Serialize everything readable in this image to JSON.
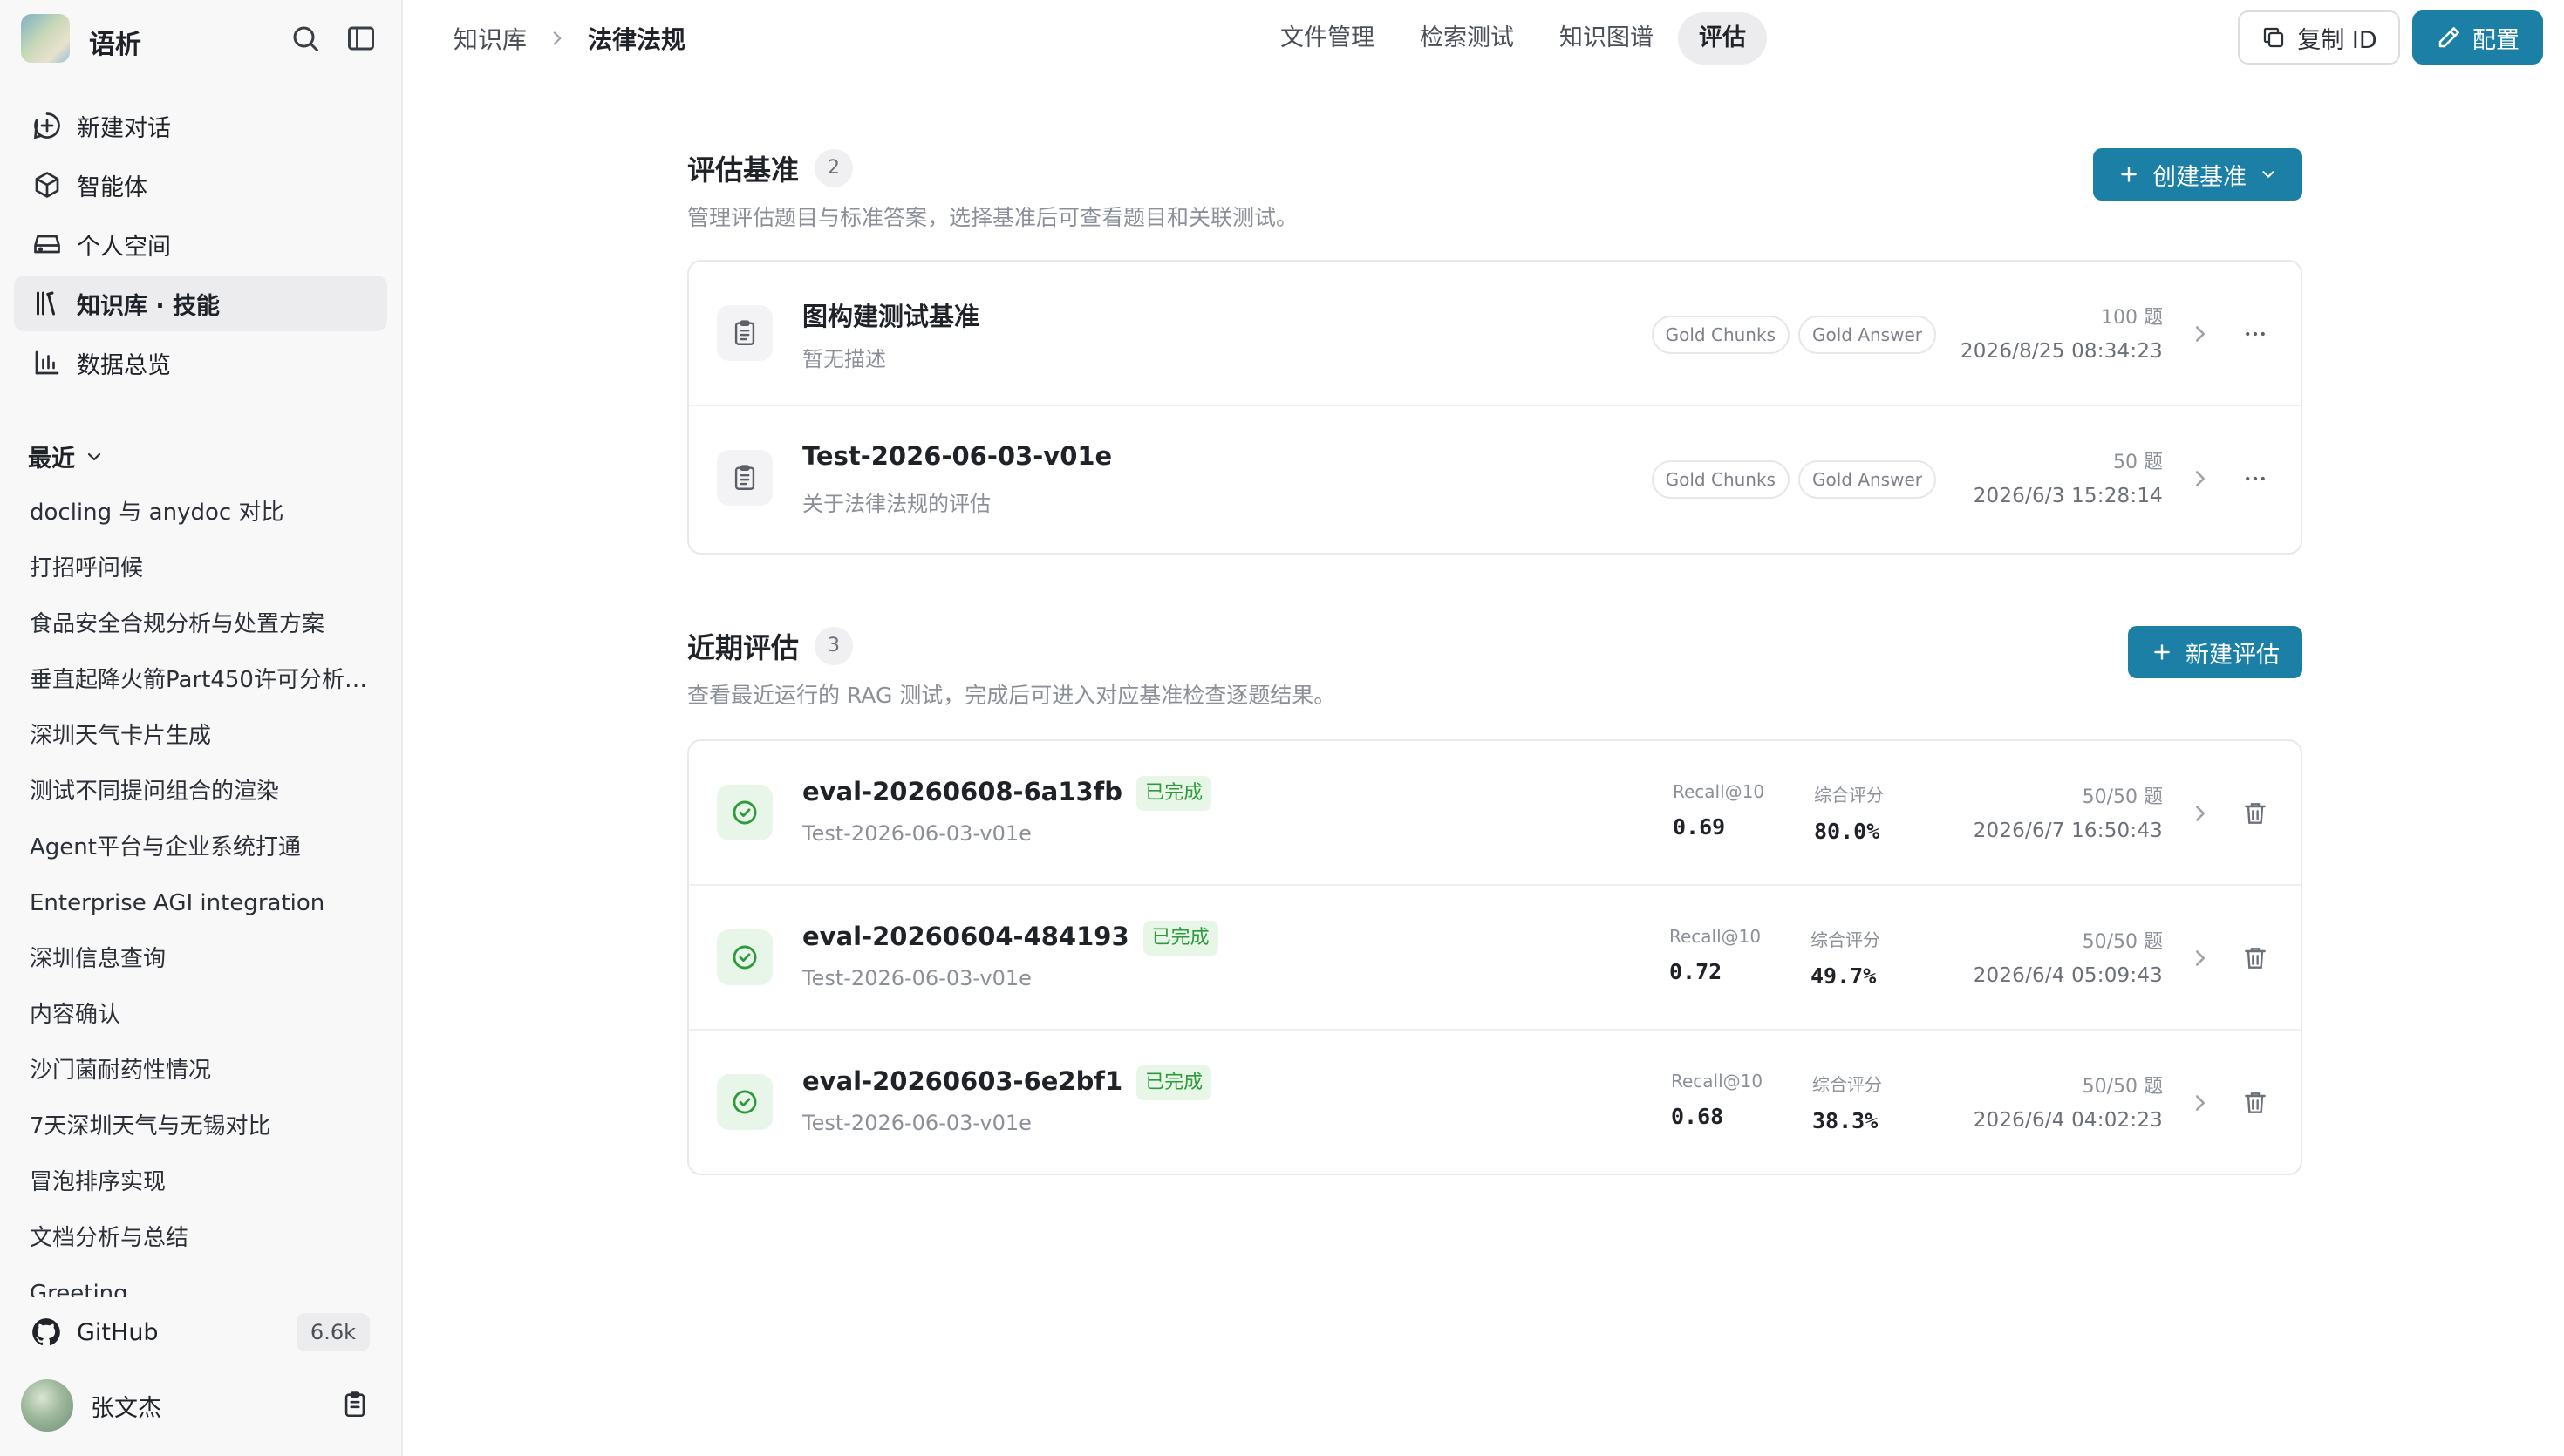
{
  "app": {
    "name": "语析"
  },
  "nav": [
    {
      "label": "新建对话",
      "icon": "new-chat-icon"
    },
    {
      "label": "智能体",
      "icon": "cube-icon"
    },
    {
      "label": "个人空间",
      "icon": "drive-icon"
    },
    {
      "label": "知识库 · 技能",
      "icon": "library-icon",
      "active": true
    },
    {
      "label": "数据总览",
      "icon": "bar-chart-icon"
    }
  ],
  "recent": {
    "title": "最近",
    "items": [
      "docling 与 anydoc 对比",
      "打招呼问候",
      "食品安全合规分析与处置方案",
      "垂直起降火箭Part450许可分析与...",
      "深圳天气卡片生成",
      "测试不同提问组合的渲染",
      "Agent平台与企业系统打通",
      "Enterprise AGI integration",
      "深圳信息查询",
      "内容确认",
      "沙门菌耐药性情况",
      "7天深圳天气与无锡对比",
      "冒泡排序实现",
      "文档分析与总结",
      "Greeting"
    ]
  },
  "github": {
    "label": "GitHub",
    "count": "6.6k"
  },
  "user": {
    "name": "张文杰"
  },
  "header": {
    "breadcrumb": [
      "知识库",
      "法律法规"
    ],
    "tabs": [
      "文件管理",
      "检索测试",
      "知识图谱",
      "评估"
    ],
    "active_tab": 3,
    "copy_id_label": "复制 ID",
    "config_label": "配置"
  },
  "benchmarks": {
    "title": "评估基准",
    "count": "2",
    "description": "管理评估题目与标准答案，选择基准后可查看题目和关联测试。",
    "create_label": "创建基准",
    "items": [
      {
        "title": "图构建测试基准",
        "desc": "暂无描述",
        "chips": [
          "Gold Chunks",
          "Gold Answer"
        ],
        "questions": "100 题",
        "date": "2026/8/25 08:34:23"
      },
      {
        "title": "Test-2026-06-03-v01e",
        "desc": "关于法律法规的评估",
        "chips": [
          "Gold Chunks",
          "Gold Answer"
        ],
        "questions": "50 题",
        "date": "2026/6/3 15:28:14"
      }
    ]
  },
  "evaluations": {
    "title": "近期评估",
    "count": "3",
    "description": "查看最近运行的 RAG 测试，完成后可进入对应基准检查逐题结果。",
    "new_label": "新建评估",
    "metric_labels": [
      "Recall@10",
      "综合评分"
    ],
    "items": [
      {
        "title": "eval-20260608-6a13fb",
        "status": "已完成",
        "benchmark": "Test-2026-06-03-v01e",
        "recall": "0.69",
        "score": "80.0%",
        "questions": "50/50 题",
        "date": "2026/6/7 16:50:43"
      },
      {
        "title": "eval-20260604-484193",
        "status": "已完成",
        "benchmark": "Test-2026-06-03-v01e",
        "recall": "0.72",
        "score": "49.7%",
        "questions": "50/50 题",
        "date": "2026/6/4 05:09:43"
      },
      {
        "title": "eval-20260603-6e2bf1",
        "status": "已完成",
        "benchmark": "Test-2026-06-03-v01e",
        "recall": "0.68",
        "score": "38.3%",
        "questions": "50/50 题",
        "date": "2026/6/4 04:02:23"
      }
    ]
  },
  "colors": {
    "accent": "#1c7fa6",
    "success": "#2e9a3c",
    "sidebar_bg": "#f8f8f9"
  }
}
